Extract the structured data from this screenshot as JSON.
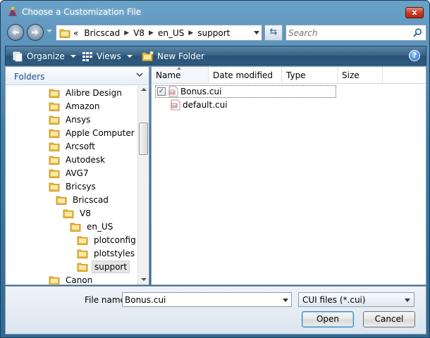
{
  "window": {
    "title": "Choose a Customization File",
    "close_label": "x"
  },
  "nav": {
    "breadcrumb_prefix": "«",
    "breadcrumbs": [
      "Bricscad",
      "V8",
      "en_US",
      "support"
    ],
    "search_placeholder": "Search"
  },
  "toolbar": {
    "organize_label": "Organize",
    "views_label": "Views",
    "new_folder_label": "New Folder",
    "help_label": "?"
  },
  "folders": {
    "title": "Folders",
    "items": [
      {
        "label": "Alibre Design",
        "level": 0
      },
      {
        "label": "Amazon",
        "level": 0
      },
      {
        "label": "Ansys",
        "level": 0
      },
      {
        "label": "Apple Computer",
        "level": 0
      },
      {
        "label": "Arcsoft",
        "level": 0
      },
      {
        "label": "Autodesk",
        "level": 0
      },
      {
        "label": "AVG7",
        "level": 0
      },
      {
        "label": "Bricsys",
        "level": 0
      },
      {
        "label": "Bricscad",
        "level": 1
      },
      {
        "label": "V8",
        "level": 2
      },
      {
        "label": "en_US",
        "level": 3
      },
      {
        "label": "plotconfig",
        "level": 4
      },
      {
        "label": "plotstyles",
        "level": 4
      },
      {
        "label": "support",
        "level": 4,
        "selected": true
      },
      {
        "label": "Canon",
        "level": 0
      }
    ]
  },
  "files": {
    "columns": [
      "Name",
      "Date modified",
      "Type",
      "Size"
    ],
    "rows": [
      {
        "name": "Bonus.cui",
        "checked": true,
        "selected": true
      },
      {
        "name": "default.cui",
        "checked": false,
        "selected": false
      }
    ]
  },
  "footer": {
    "file_name_label": "File name:",
    "file_name_value": "Bonus.cui",
    "file_type": "CUI files (*.cui)",
    "open_label": "Open",
    "cancel_label": "Cancel"
  },
  "colors": {
    "title_bar": "#3e7ba7",
    "toolbar": "#375f82",
    "close_button": "#c33a22",
    "folder_icon": "#e8b93b"
  }
}
